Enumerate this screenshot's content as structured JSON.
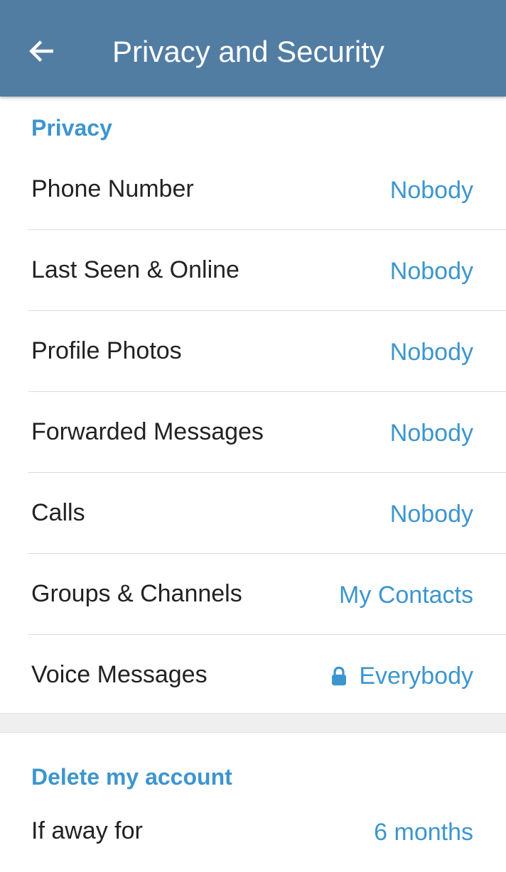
{
  "appbar": {
    "title": "Privacy and Security",
    "back_icon": "arrow-left-icon",
    "background_color": "#527da3"
  },
  "privacy": {
    "header": "Privacy",
    "items": [
      {
        "label": "Phone Number",
        "value": "Nobody"
      },
      {
        "label": "Last Seen & Online",
        "value": "Nobody"
      },
      {
        "label": "Profile Photos",
        "value": "Nobody"
      },
      {
        "label": "Forwarded Messages",
        "value": "Nobody"
      },
      {
        "label": "Calls",
        "value": "Nobody"
      },
      {
        "label": "Groups & Channels",
        "value": "My Contacts"
      },
      {
        "label": "Voice Messages",
        "value": "Everybody",
        "icon": "lock-icon"
      }
    ]
  },
  "delete_account": {
    "header": "Delete my account",
    "items": [
      {
        "label": "If away for",
        "value": "6 months"
      }
    ]
  },
  "colors": {
    "accent": "#3d95ce",
    "text": "#222222"
  }
}
